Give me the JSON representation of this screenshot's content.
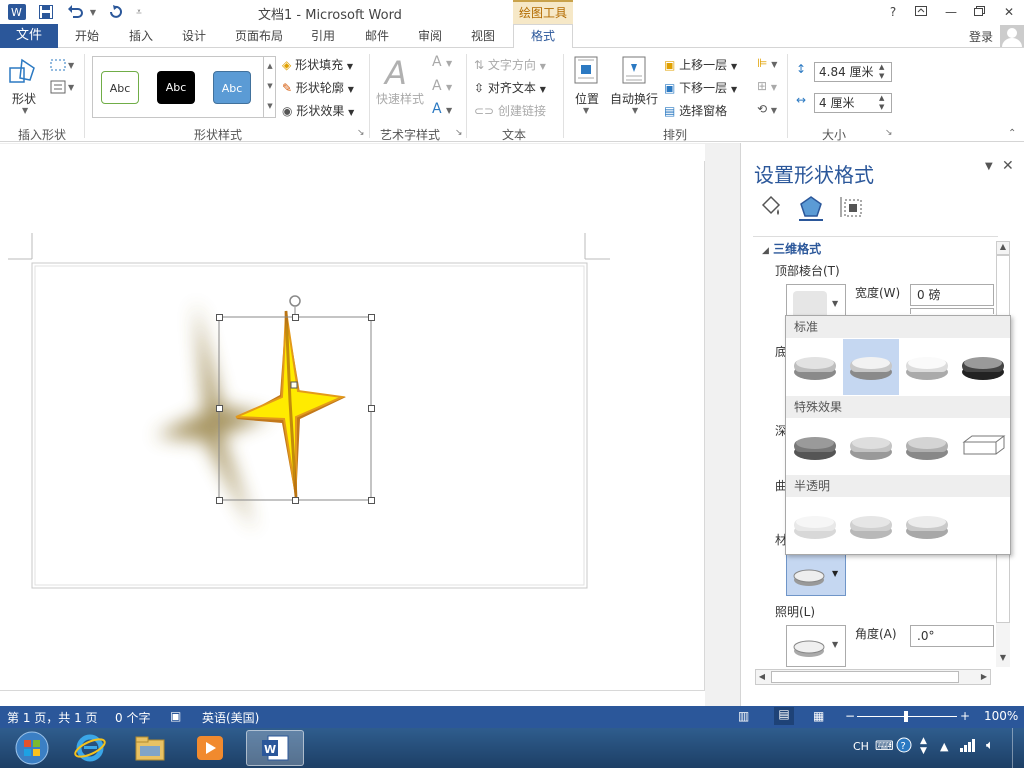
{
  "window": {
    "title": "文档1 - Microsoft Word",
    "context_tab": "绘图工具",
    "help": "?",
    "controls": [
      "ribbon-options",
      "minimize",
      "restore",
      "close"
    ]
  },
  "tabs": {
    "file": "文件",
    "items": [
      "开始",
      "插入",
      "设计",
      "页面布局",
      "引用",
      "邮件",
      "审阅",
      "视图"
    ],
    "active": "格式",
    "login": "登录"
  },
  "ribbon": {
    "insert_shapes": {
      "shapes_label": "形状",
      "group_label": "插入形状"
    },
    "shape_styles": {
      "samples": [
        "Abc",
        "Abc",
        "Abc"
      ],
      "fill": "形状填充",
      "outline": "形状轮廓",
      "effects": "形状效果",
      "group_label": "形状样式"
    },
    "wordart": {
      "quick_styles": "快速样式",
      "group_label": "艺术字样式"
    },
    "text": {
      "direction": "文字方向",
      "align": "对齐文本",
      "link": "创建链接",
      "group_label": "文本"
    },
    "arrange": {
      "position": "位置",
      "wrap": "自动换行",
      "forward": "上移一层",
      "backward": "下移一层",
      "selection_pane": "选择窗格",
      "group_label": "排列"
    },
    "size": {
      "height": "4.84 厘米",
      "width": "4 厘米",
      "group_label": "大小"
    }
  },
  "pane": {
    "title": "设置形状格式",
    "section": "三维格式",
    "top_bevel": "顶部棱台(T)",
    "width_label": "宽度(W)",
    "width_value": "0 磅",
    "bottom_bevel_partial": "底",
    "depth_partial": "深",
    "contour_partial": "曲",
    "material_partial": "材",
    "lighting": "照明(L)",
    "angle_label": "角度(A)",
    "angle_value": ".0°"
  },
  "gallery": {
    "sections": [
      {
        "title": "标准",
        "count": 4,
        "selected": 1
      },
      {
        "title": "特殊效果",
        "count": 4,
        "selected": -1
      },
      {
        "title": "半透明",
        "count": 3,
        "selected": -1
      }
    ]
  },
  "status": {
    "page": "第 1 页，共 1 页",
    "words": "0 个字",
    "language": "英语(美国)",
    "zoom": "100%"
  },
  "taskbar": {
    "tray_lang": "CH"
  },
  "colors": {
    "brand_blue": "#2b579a",
    "star_fill": "#ffeb00",
    "star_outline": "#e39a1a",
    "gallery_selected": "#c5d7f1"
  }
}
